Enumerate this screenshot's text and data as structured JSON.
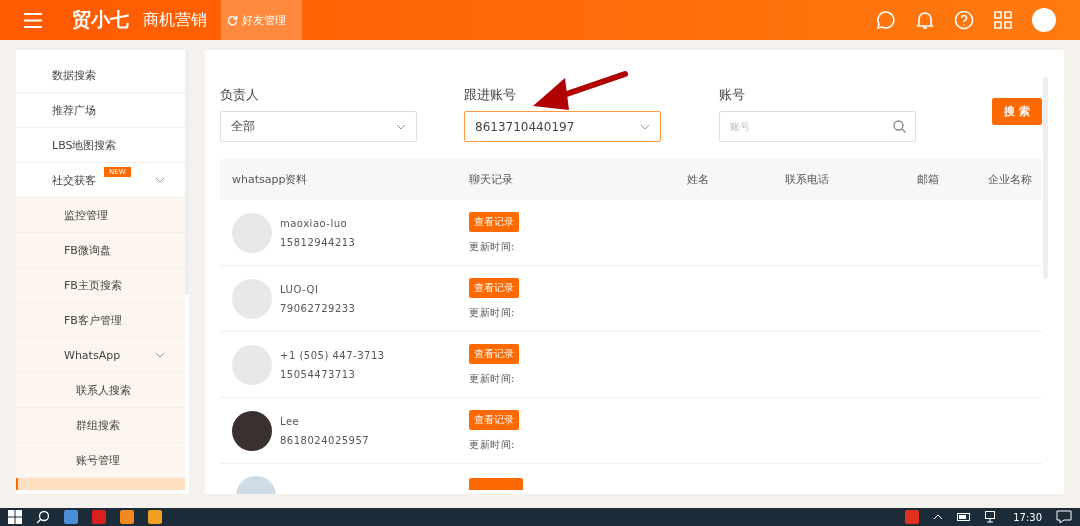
{
  "header": {
    "brand": "贸小七",
    "section": "商机营销",
    "tab": "好友管理"
  },
  "sidebar": {
    "items": [
      {
        "label": "数据搜索",
        "selected": false
      },
      {
        "label": "推荐广场",
        "selected": false
      },
      {
        "label": "LBS地图搜索",
        "selected": false
      },
      {
        "label": "社交获客",
        "badge": "NEW",
        "expanded": true,
        "selected": false,
        "children": [
          {
            "label": "监控管理",
            "selected": false
          },
          {
            "label": "FB微询盘",
            "selected": false
          },
          {
            "label": "FB主页搜索",
            "selected": false
          },
          {
            "label": "FB客户管理",
            "selected": false
          },
          {
            "label": "WhatsApp",
            "expanded": true,
            "selected": false,
            "children": [
              {
                "label": "联系人搜索",
                "selected": false
              },
              {
                "label": "群组搜索",
                "selected": false
              },
              {
                "label": "账号管理",
                "selected": false
              }
            ]
          }
        ]
      }
    ]
  },
  "filters": [
    {
      "kind": "select",
      "label": "负责人",
      "value": "全部",
      "focused": false
    },
    {
      "kind": "select",
      "label": "跟进账号",
      "value": "8613710440197",
      "focused": true
    },
    {
      "kind": "search",
      "label": "账号",
      "placeholder": "账号"
    }
  ],
  "search_button": "搜 索",
  "table": {
    "columns": [
      "whatsapp资料",
      "聊天记录",
      "姓名",
      "联系电话",
      "邮箱",
      "企业名称"
    ],
    "rows": [
      {
        "name": "maoxiao-luo",
        "number": "15812944213",
        "has_photo": false,
        "action": "查看记录",
        "updated": "更新时间:"
      },
      {
        "name": "LUO-QI",
        "number": "79062729233",
        "has_photo": false,
        "action": "查看记录",
        "updated": "更新时间:"
      },
      {
        "name": "+1 (505) 447-3713",
        "number": "15054473713",
        "has_photo": false,
        "action": "查看记录",
        "updated": "更新时间:"
      },
      {
        "name": "Lee",
        "number": "8618024025957",
        "has_photo": true,
        "action": "查看记录",
        "updated": "更新时间:"
      }
    ]
  },
  "taskbar": {
    "time": "17:30"
  }
}
